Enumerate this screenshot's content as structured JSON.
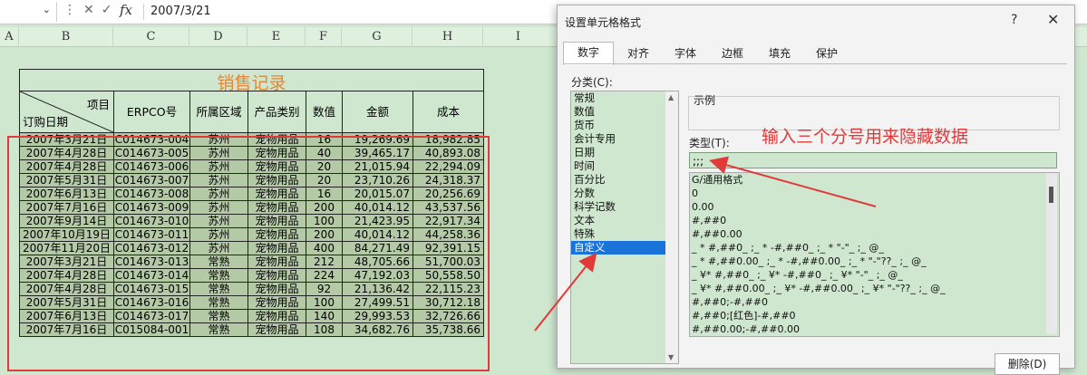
{
  "formula_bar": {
    "cell_value": "2007/3/21",
    "fx_label": "fx"
  },
  "columns": [
    "A",
    "B",
    "C",
    "D",
    "E",
    "F",
    "G",
    "H",
    "I"
  ],
  "sheet": {
    "title": "销售记录",
    "headers": {
      "diag_top": "项目",
      "diag_bottom": "订购日期",
      "erp": "ERPCO号",
      "region": "所属区域",
      "category": "产品类别",
      "qty": "数值",
      "amount": "金额",
      "cost": "成本"
    },
    "rows": [
      [
        "2007年3月21日",
        "C014673-004",
        "苏州",
        "宠物用品",
        "16",
        "19,269.69",
        "18,982.85"
      ],
      [
        "2007年4月28日",
        "C014673-005",
        "苏州",
        "宠物用品",
        "40",
        "39,465.17",
        "40,893.08"
      ],
      [
        "2007年4月28日",
        "C014673-006",
        "苏州",
        "宠物用品",
        "20",
        "21,015.94",
        "22,294.09"
      ],
      [
        "2007年5月31日",
        "C014673-007",
        "苏州",
        "宠物用品",
        "20",
        "23,710.26",
        "24,318.37"
      ],
      [
        "2007年6月13日",
        "C014673-008",
        "苏州",
        "宠物用品",
        "16",
        "20,015.07",
        "20,256.69"
      ],
      [
        "2007年7月16日",
        "C014673-009",
        "苏州",
        "宠物用品",
        "200",
        "40,014.12",
        "43,537.56"
      ],
      [
        "2007年9月14日",
        "C014673-010",
        "苏州",
        "宠物用品",
        "100",
        "21,423.95",
        "22,917.34"
      ],
      [
        "2007年10月19日",
        "C014673-011",
        "苏州",
        "宠物用品",
        "200",
        "40,014.12",
        "44,258.36"
      ],
      [
        "2007年11月20日",
        "C014673-012",
        "苏州",
        "宠物用品",
        "400",
        "84,271.49",
        "92,391.15"
      ],
      [
        "2007年3月21日",
        "C014673-013",
        "常熟",
        "宠物用品",
        "212",
        "48,705.66",
        "51,700.03"
      ],
      [
        "2007年4月28日",
        "C014673-014",
        "常熟",
        "宠物用品",
        "224",
        "47,192.03",
        "50,558.50"
      ],
      [
        "2007年4月28日",
        "C014673-015",
        "常熟",
        "宠物用品",
        "92",
        "21,136.42",
        "22,115.23"
      ],
      [
        "2007年5月31日",
        "C014673-016",
        "常熟",
        "宠物用品",
        "100",
        "27,499.51",
        "30,712.18"
      ],
      [
        "2007年6月13日",
        "C014673-017",
        "常熟",
        "宠物用品",
        "140",
        "29,993.53",
        "32,726.66"
      ],
      [
        "2007年7月16日",
        "C015084-001",
        "常熟",
        "宠物用品",
        "108",
        "34,682.76",
        "35,738.66"
      ]
    ]
  },
  "dialog": {
    "title": "设置单元格格式",
    "help": "?",
    "close": "✕",
    "tabs": [
      "数字",
      "对齐",
      "字体",
      "边框",
      "填充",
      "保护"
    ],
    "category_label": "分类(C):",
    "categories": [
      "常规",
      "数值",
      "货币",
      "会计专用",
      "日期",
      "时间",
      "百分比",
      "分数",
      "科学记数",
      "文本",
      "特殊",
      "自定义"
    ],
    "selected_category": "自定义",
    "sample_label": "示例",
    "type_label": "类型(T):",
    "type_value": ";;;",
    "formats": [
      "G/通用格式",
      "0",
      "0.00",
      "#,##0",
      "#,##0.00",
      "_ * #,##0_ ;_ * -#,##0_ ;_ * \"-\"_ ;_ @_",
      "_ * #,##0.00_ ;_ * -#,##0.00_ ;_ * \"-\"??_ ;_ @_",
      "_ ¥* #,##0_ ;_ ¥* -#,##0_ ;_ ¥* \"-\"_ ;_ @_",
      "_ ¥* #,##0.00_ ;_ ¥* -#,##0.00_ ;_ ¥* \"-\"??_ ;_ @_",
      "#,##0;-#,##0",
      "#,##0;[红色]-#,##0",
      "#,##0.00;-#,##0.00"
    ],
    "delete_label": "删除(D)"
  },
  "annotation": "输入三个分号用来隐藏数据",
  "colors": {
    "annotation": "#e03a3a",
    "title": "#e0883a",
    "row_fill": "#b4c9a6",
    "selected": "#1a73d9"
  }
}
